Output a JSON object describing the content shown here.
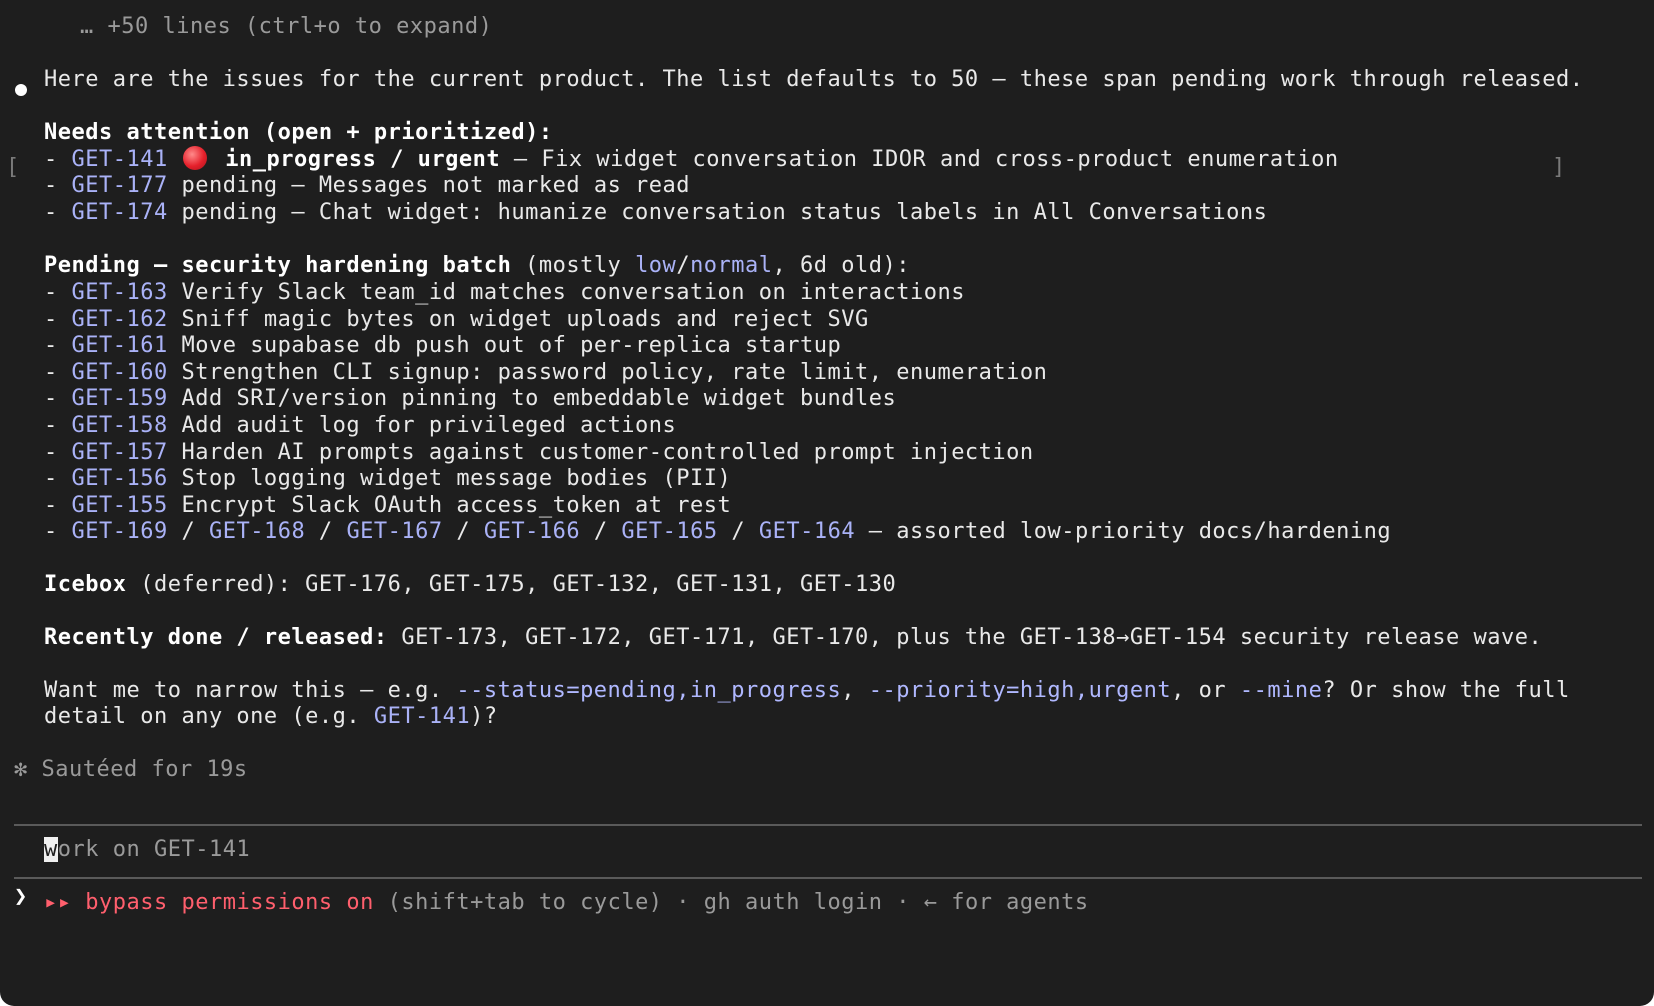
{
  "header": {
    "collapsed_note": "… +50 lines (ctrl+o to expand)"
  },
  "intro": "Here are the issues for the current product. The list defaults to 50 — these span pending work through released.",
  "attention": {
    "heading": "Needs attention (open + prioritized):",
    "items": [
      {
        "id": "GET-141",
        "status": "in_progress / urgent",
        "text": " — Fix widget conversation IDOR and cross-product enumeration"
      },
      {
        "id": "GET-177",
        "text": " pending — Messages not marked as read"
      },
      {
        "id": "GET-174",
        "text": " pending — Chat widget: humanize conversation status labels in All Conversations"
      }
    ]
  },
  "pending": {
    "heading": "Pending — security hardening batch",
    "note_prefix": " (mostly ",
    "low": "low",
    "slash": "/",
    "normal": "normal",
    "note_suffix": ", 6d old):",
    "items": [
      {
        "id": "GET-163",
        "text": " Verify Slack team_id matches conversation on interactions"
      },
      {
        "id": "GET-162",
        "text": " Sniff magic bytes on widget uploads and reject SVG"
      },
      {
        "id": "GET-161",
        "text": " Move supabase db push out of per-replica startup"
      },
      {
        "id": "GET-160",
        "text": " Strengthen CLI signup: password policy, rate limit, enumeration"
      },
      {
        "id": "GET-159",
        "text": " Add SRI/version pinning to embeddable widget bundles"
      },
      {
        "id": "GET-158",
        "text": " Add audit log for privileged actions"
      },
      {
        "id": "GET-157",
        "text": " Harden AI prompts against customer-controlled prompt injection"
      },
      {
        "id": "GET-156",
        "text": " Stop logging widget message bodies (PII)"
      },
      {
        "id": "GET-155",
        "text": " Encrypt Slack OAuth access_token at rest"
      }
    ],
    "group_ids": [
      "GET-169",
      "GET-168",
      "GET-167",
      "GET-166",
      "GET-165",
      "GET-164"
    ],
    "group_sep": " / ",
    "group_text": " — assorted low-priority docs/hardening"
  },
  "icebox": {
    "label": "Icebox",
    "text": " (deferred): GET-176, GET-175, GET-132, GET-131, GET-130"
  },
  "done": {
    "label": "Recently done / released:",
    "text": " GET-173, GET-172, GET-171, GET-170, plus the GET-138→GET-154 security release wave."
  },
  "question": {
    "part1": "Want me to narrow this — e.g. ",
    "flag1": "--status=pending,in_progress",
    "part2": ", ",
    "flag2": "--priority=high,urgent",
    "part3": ", or ",
    "flag3": "--mine",
    "part4": "? Or show the full",
    "line2_prefix": "detail on any one (e.g. ",
    "line2_id": "GET-141",
    "line2_suffix": ")?"
  },
  "status": {
    "symbol": "✻",
    "text": "Sautéed for 19s"
  },
  "prompt": {
    "arrow": "❯",
    "cursor_char": "w",
    "placeholder_rest": "ork on GET-141"
  },
  "footer": {
    "mode_icon": "▸▸",
    "mode_text": "bypass permissions on",
    "rest": " (shift+tab to cycle) · gh auth login · ← for agents"
  },
  "brackets": {
    "left": "[",
    "right": "]"
  },
  "dash": "- ",
  "colors": {
    "background": "#1e1e1e",
    "link": "#aab2f7",
    "danger": "#ff5f6d",
    "urgent_dot": "#e5202b"
  }
}
